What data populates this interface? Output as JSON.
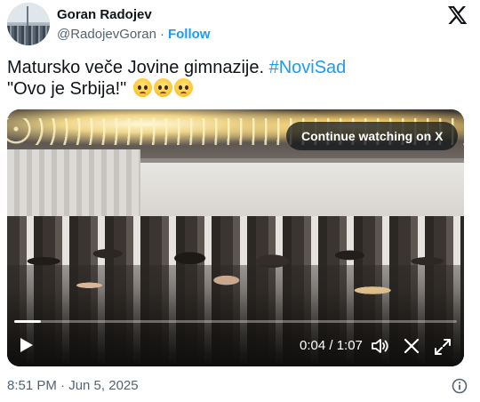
{
  "author": {
    "name": "Goran Radojev",
    "handle": "@RadojevGoran",
    "separator": "·",
    "follow_label": "Follow"
  },
  "post": {
    "line1_text": "Matursko veče Jovine gimnazije.",
    "hashtag": "#NoviSad",
    "line2_text": "\"Ovo je Srbija!\"",
    "emoji_name": "face-holding-back-tears-icon",
    "emoji_count": 3
  },
  "video": {
    "continue_label": "Continue watching on X",
    "time_display": "0:04 / 1:07",
    "progress_fraction": 0.06,
    "icons": [
      "play-icon",
      "volume-icon",
      "close-icon",
      "expand-icon"
    ]
  },
  "footer": {
    "timestamp": "8:51 PM · Jun 5, 2025",
    "info_icon": "info-icon"
  },
  "colors": {
    "text": "#0f1419",
    "secondary": "#536471",
    "accent": "#1d9bf0"
  },
  "brand_icon": "x-logo-icon"
}
